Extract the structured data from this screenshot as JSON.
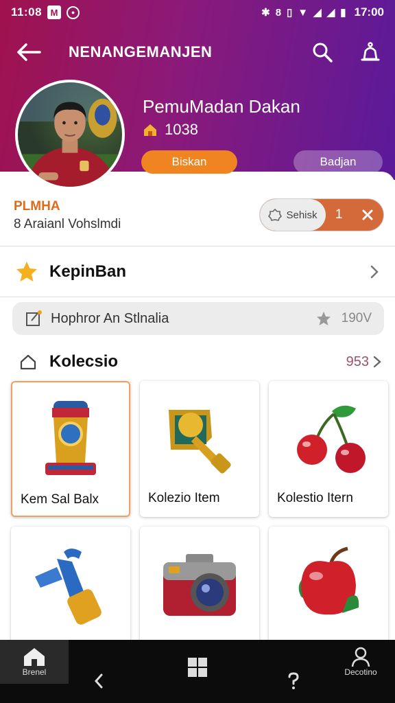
{
  "status": {
    "time": "11:08",
    "clock": "17:00"
  },
  "appbar": {
    "title": "NENANGEMANJEN"
  },
  "profile": {
    "name": "PemuMadan Dakan",
    "stat": "1038",
    "primary_btn": "Biskan",
    "secondary_btn": "Badjan"
  },
  "rank": {
    "label": "PLMHA",
    "sub": "8 Araianl Vohslmdi",
    "toggle_label": "Sehisk",
    "toggle_value": "1"
  },
  "menu": {
    "label": "KepinBan"
  },
  "pill": {
    "text": "Hophror An Stlnalia",
    "right_text": "190V"
  },
  "collection": {
    "title": "Kolecsio",
    "count": "953",
    "items": [
      {
        "name": "Kem Sal Balx",
        "icon": "trophy-icon"
      },
      {
        "name": "Kolezio Item",
        "icon": "golden-trophy-icon"
      },
      {
        "name": "Kolestio Itern",
        "icon": "cherries-icon"
      },
      {
        "name": "",
        "icon": "water-tap-icon"
      },
      {
        "name": "",
        "icon": "camera-icon"
      },
      {
        "name": "",
        "icon": "apple-icon"
      }
    ]
  },
  "bottom_nav": {
    "home_label": "Brenel",
    "profile_label": "Decotino"
  },
  "colors": {
    "header_start": "#a0124e",
    "header_end": "#5a1a9a",
    "accent": "#f08420",
    "rank": "#e06a1a"
  }
}
